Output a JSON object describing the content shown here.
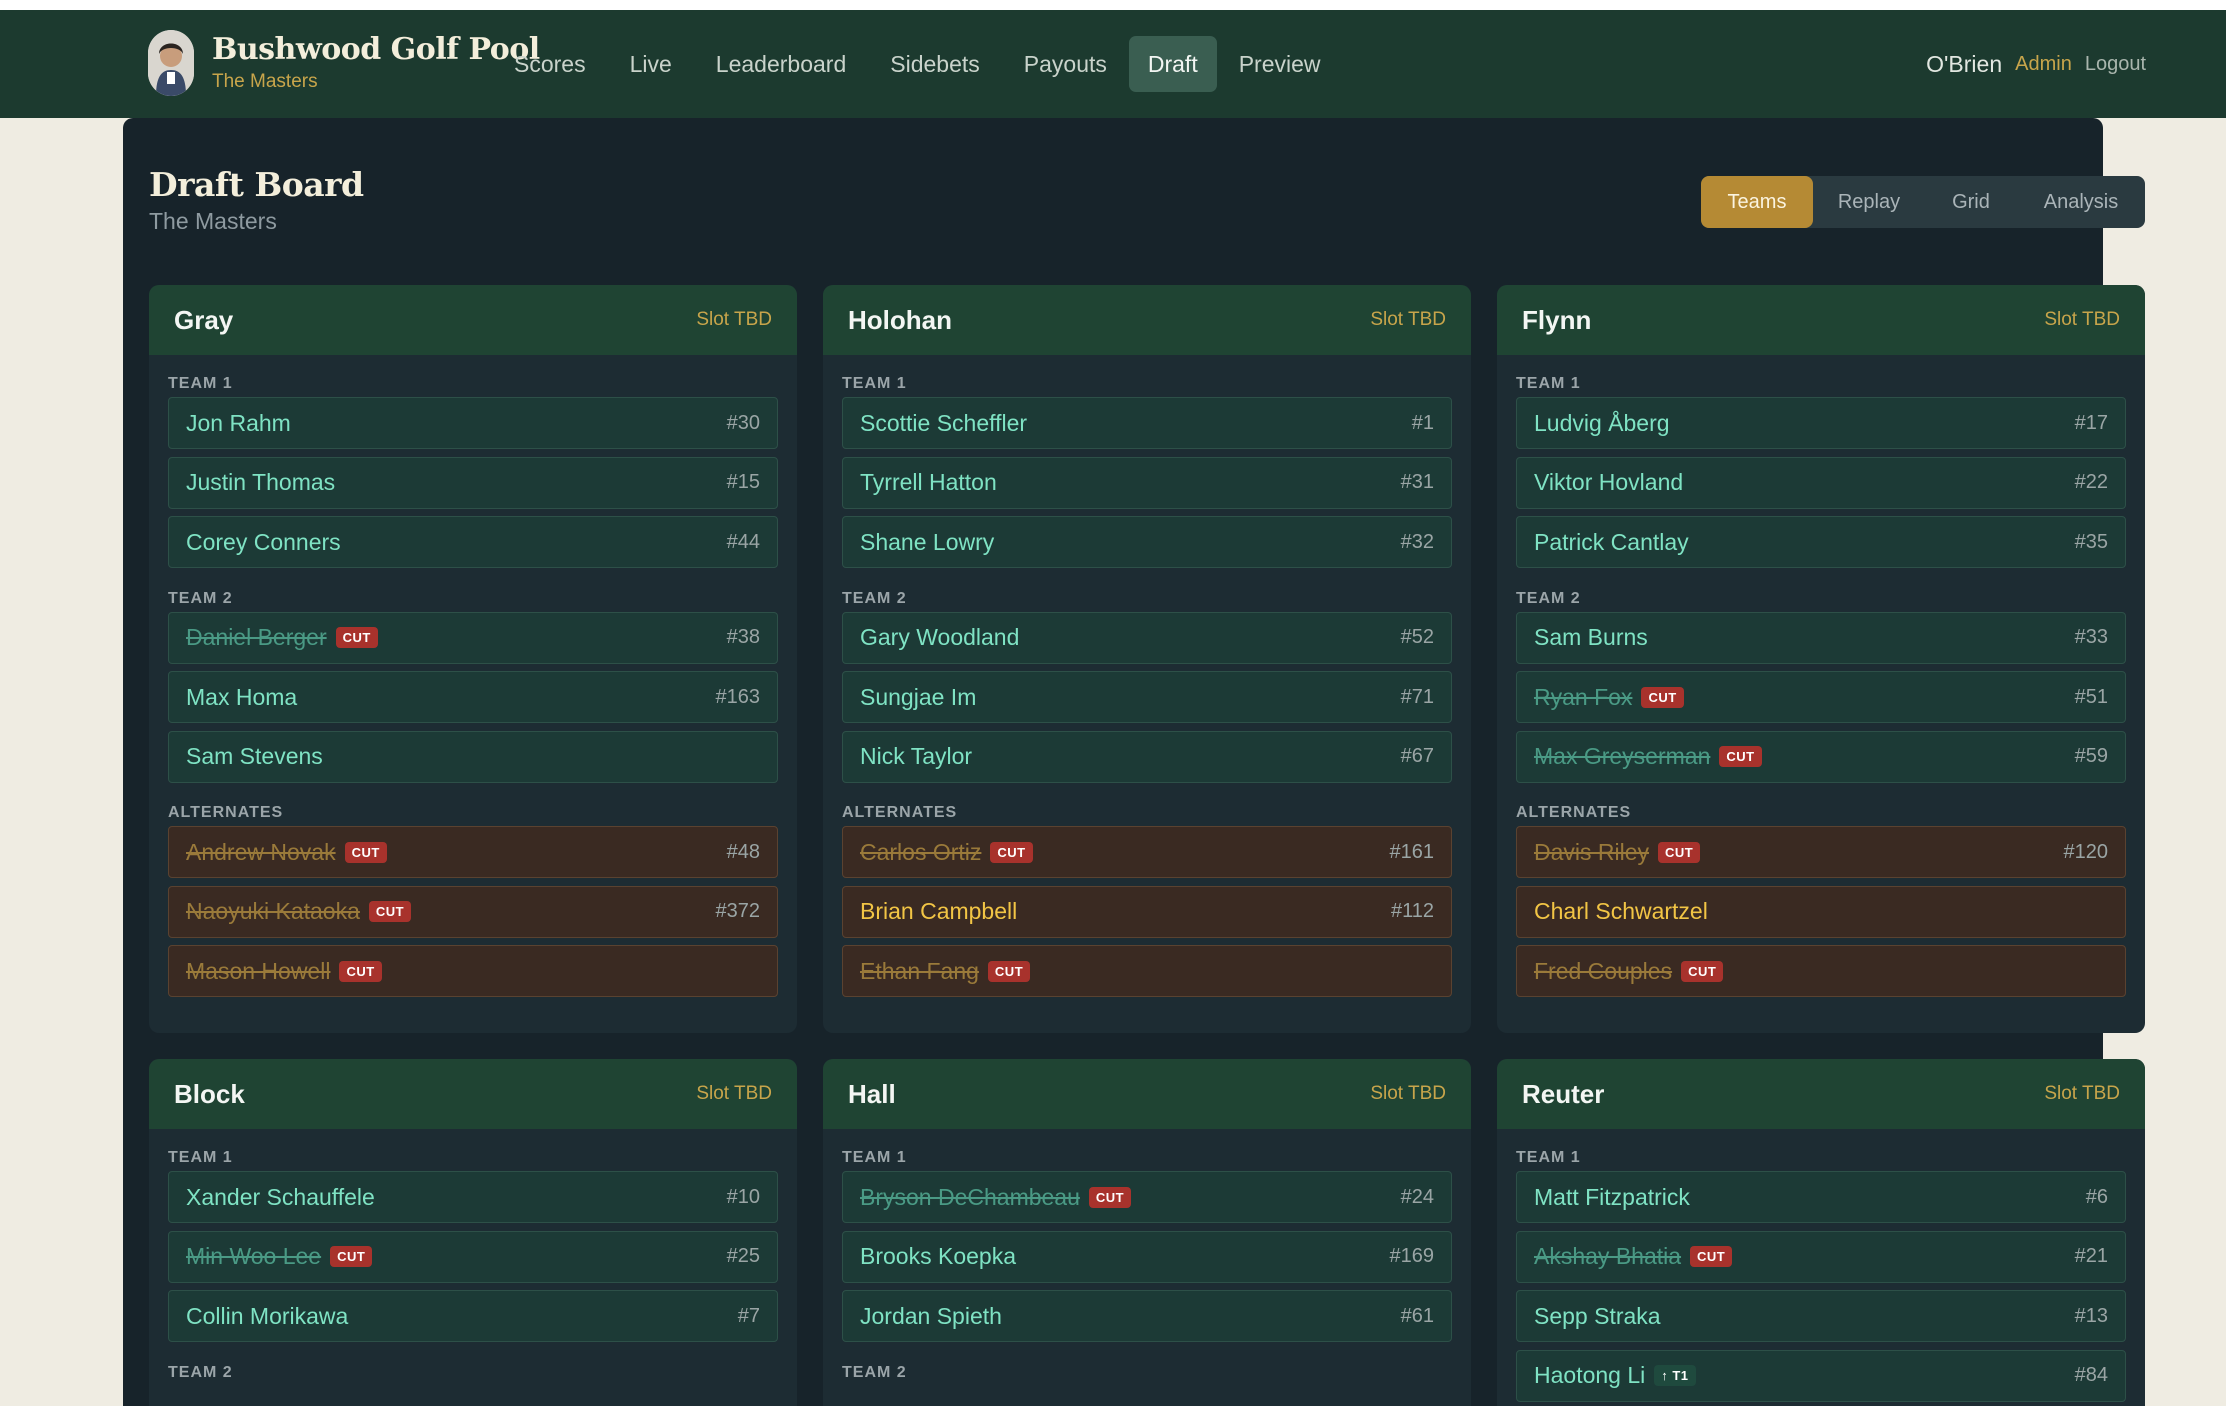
{
  "brand": {
    "title": "Bushwood Golf Pool",
    "subtitle": "The Masters"
  },
  "nav": {
    "items": [
      {
        "label": "Scores",
        "active": false
      },
      {
        "label": "Live",
        "active": false
      },
      {
        "label": "Leaderboard",
        "active": false
      },
      {
        "label": "Sidebets",
        "active": false
      },
      {
        "label": "Payouts",
        "active": false
      },
      {
        "label": "Draft",
        "active": true
      },
      {
        "label": "Preview",
        "active": false
      }
    ],
    "user": "O'Brien",
    "admin_label": "Admin",
    "logout_label": "Logout"
  },
  "page": {
    "title": "Draft Board",
    "subtitle": "The Masters",
    "views": [
      "Teams",
      "Replay",
      "Grid",
      "Analysis"
    ],
    "active_view": "Teams"
  },
  "labels": {
    "team1": "TEAM 1",
    "team2": "TEAM 2",
    "alternates": "ALTERNATES",
    "cut": "CUT"
  },
  "cards": [
    {
      "owner": "Gray",
      "slot": "Slot TBD",
      "team1": [
        {
          "name": "Jon Rahm",
          "rank": "#30"
        },
        {
          "name": "Justin Thomas",
          "rank": "#15"
        },
        {
          "name": "Corey Conners",
          "rank": "#44"
        }
      ],
      "team2": [
        {
          "name": "Daniel Berger",
          "rank": "#38",
          "cut": true
        },
        {
          "name": "Max Homa",
          "rank": "#163"
        },
        {
          "name": "Sam Stevens",
          "rank": ""
        }
      ],
      "alternates": [
        {
          "name": "Andrew Novak",
          "rank": "#48",
          "cut": true
        },
        {
          "name": "Naoyuki Kataoka",
          "rank": "#372",
          "cut": true
        },
        {
          "name": "Mason Howell",
          "rank": "",
          "cut": true
        }
      ]
    },
    {
      "owner": "Holohan",
      "slot": "Slot TBD",
      "team1": [
        {
          "name": "Scottie Scheffler",
          "rank": "#1"
        },
        {
          "name": "Tyrrell Hatton",
          "rank": "#31"
        },
        {
          "name": "Shane Lowry",
          "rank": "#32"
        }
      ],
      "team2": [
        {
          "name": "Gary Woodland",
          "rank": "#52"
        },
        {
          "name": "Sungjae Im",
          "rank": "#71"
        },
        {
          "name": "Nick Taylor",
          "rank": "#67"
        }
      ],
      "alternates": [
        {
          "name": "Carlos Ortiz",
          "rank": "#161",
          "cut": true
        },
        {
          "name": "Brian Campbell",
          "rank": "#112"
        },
        {
          "name": "Ethan Fang",
          "rank": "",
          "cut": true
        }
      ]
    },
    {
      "owner": "Flynn",
      "slot": "Slot TBD",
      "team1": [
        {
          "name": "Ludvig Åberg",
          "rank": "#17"
        },
        {
          "name": "Viktor Hovland",
          "rank": "#22"
        },
        {
          "name": "Patrick Cantlay",
          "rank": "#35"
        }
      ],
      "team2": [
        {
          "name": "Sam Burns",
          "rank": "#33"
        },
        {
          "name": "Ryan Fox",
          "rank": "#51",
          "cut": true
        },
        {
          "name": "Max Greyserman",
          "rank": "#59",
          "cut": true
        }
      ],
      "alternates": [
        {
          "name": "Davis Riley",
          "rank": "#120",
          "cut": true
        },
        {
          "name": "Charl Schwartzel",
          "rank": ""
        },
        {
          "name": "Fred Couples",
          "rank": "",
          "cut": true
        }
      ]
    },
    {
      "owner": "Block",
      "slot": "Slot TBD",
      "team1": [
        {
          "name": "Xander Schauffele",
          "rank": "#10"
        },
        {
          "name": "Min Woo Lee",
          "rank": "#25",
          "cut": true
        },
        {
          "name": "Collin Morikawa",
          "rank": "#7"
        }
      ],
      "team2": [],
      "alternates": []
    },
    {
      "owner": "Hall",
      "slot": "Slot TBD",
      "team1": [
        {
          "name": "Bryson DeChambeau",
          "rank": "#24",
          "cut": true
        },
        {
          "name": "Brooks Koepka",
          "rank": "#169"
        },
        {
          "name": "Jordan Spieth",
          "rank": "#61"
        }
      ],
      "team2": [],
      "alternates": []
    },
    {
      "owner": "Reuter",
      "slot": "Slot TBD",
      "team1": [
        {
          "name": "Matt Fitzpatrick",
          "rank": "#6"
        },
        {
          "name": "Akshay Bhatia",
          "rank": "#21",
          "cut": true
        },
        {
          "name": "Sepp Straka",
          "rank": "#13"
        },
        {
          "name": "Haotong Li",
          "rank": "#84",
          "badge": "↑ T1"
        }
      ],
      "team2": [],
      "alternates": []
    }
  ],
  "colors": {
    "nav_bg": "#1c3a2f",
    "panel_bg": "#17232a",
    "card_header": "#1f4433",
    "accent": "#c8a54b",
    "cut_badge": "#a8322c"
  }
}
